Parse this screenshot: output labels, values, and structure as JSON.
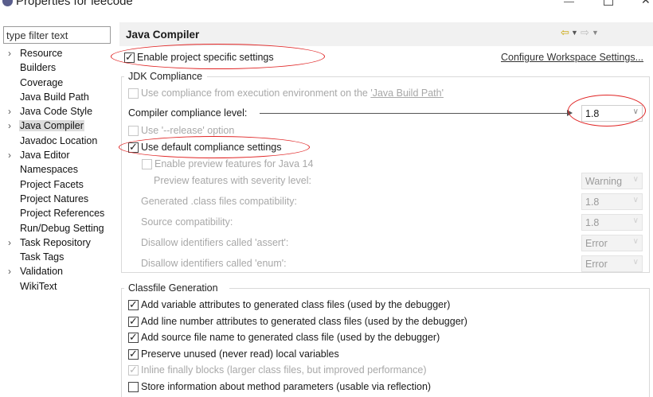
{
  "window": {
    "title": "Properties for leecode"
  },
  "filter": {
    "placeholder": "type filter text"
  },
  "tree": [
    {
      "label": "Resource",
      "expandable": true
    },
    {
      "label": "Builders",
      "expandable": false
    },
    {
      "label": "Coverage",
      "expandable": false
    },
    {
      "label": "Java Build Path",
      "expandable": false
    },
    {
      "label": "Java Code Style",
      "expandable": true
    },
    {
      "label": "Java Compiler",
      "expandable": true,
      "selected": true
    },
    {
      "label": "Javadoc Location",
      "expandable": false
    },
    {
      "label": "Java Editor",
      "expandable": true
    },
    {
      "label": "Namespaces",
      "expandable": false
    },
    {
      "label": "Project Facets",
      "expandable": false
    },
    {
      "label": "Project Natures",
      "expandable": false
    },
    {
      "label": "Project References",
      "expandable": false
    },
    {
      "label": "Run/Debug Setting",
      "expandable": false
    },
    {
      "label": "Task Repository",
      "expandable": true
    },
    {
      "label": "Task Tags",
      "expandable": false
    },
    {
      "label": "Validation",
      "expandable": true
    },
    {
      "label": "WikiText",
      "expandable": false
    }
  ],
  "page": {
    "title": "Java Compiler",
    "enable_project_settings": {
      "label": "Enable project specific settings",
      "checked": true
    },
    "configure_link": "Configure Workspace Settings...",
    "jdk": {
      "group_label": "JDK Compliance",
      "use_build_path_prefix": "Use compliance from execution environment on the ",
      "use_build_path_link": "'Java Build Path'",
      "compliance_label": "Compiler compliance level:",
      "compliance_value": "1.8",
      "release_label": "Use '--release' option",
      "use_default_label": "Use default compliance settings",
      "enable_preview_label": "Enable preview features for Java 14",
      "preview_severity_label": "Preview features with severity level:",
      "preview_severity_value": "Warning",
      "generated_label": "Generated .class files compatibility:",
      "generated_value": "1.8",
      "source_label": "Source compatibility:",
      "source_value": "1.8",
      "assert_label": "Disallow identifiers called 'assert':",
      "assert_value": "Error",
      "enum_label": "Disallow identifiers called 'enum':",
      "enum_value": "Error"
    },
    "classfile": {
      "group_label": "Classfile Generation",
      "options": [
        {
          "label": "Add variable attributes to generated class files (used by the debugger)",
          "checked": true,
          "enabled": true
        },
        {
          "label": "Add line number attributes to generated class files (used by the debugger)",
          "checked": true,
          "enabled": true
        },
        {
          "label": "Add source file name to generated class file (used by the debugger)",
          "checked": true,
          "enabled": true
        },
        {
          "label": "Preserve unused (never read) local variables",
          "checked": true,
          "enabled": true
        },
        {
          "label": "Inline finally blocks (larger class files, but improved performance)",
          "checked": true,
          "enabled": false
        },
        {
          "label": "Store information about method parameters (usable via reflection)",
          "checked": false,
          "enabled": true
        }
      ]
    }
  },
  "colors": {
    "annotation": "#e02424",
    "header_bg": "#f1f1f1",
    "selected_bg": "#dddddd",
    "back_arrow": "#c8a300"
  }
}
